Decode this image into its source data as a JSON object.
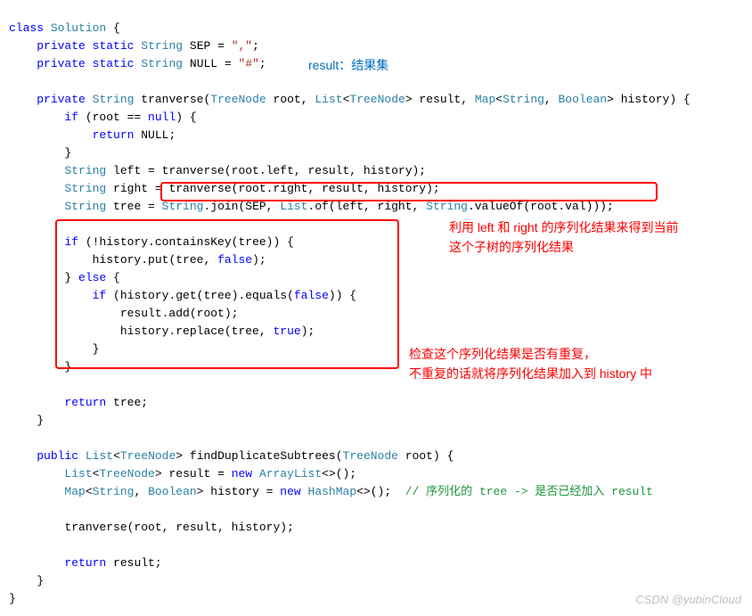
{
  "anno1": "result：结果集",
  "anno2": "利用 left 和 right 的序列化结果来得到当前\n这个子树的序列化结果",
  "anno3": "检查这个序列化结果是否有重复，\n不重复的话就将序列化结果加入到 history 中",
  "watermark": "CSDN @yubinCloud",
  "code": {
    "l01_kw1": "class",
    "l01_type1": "Solution",
    "l01_pt1": " {",
    "l02_kw1": "private",
    "l02_kw2": "static",
    "l02_type1": "String",
    "l02_id1": "SEP",
    "l02_pt1": " = ",
    "l02_str1": "\",\"",
    "l02_pt2": ";",
    "l03_kw1": "private",
    "l03_kw2": "static",
    "l03_type1": "String",
    "l03_id1": "NULL",
    "l03_pt1": " = ",
    "l03_str1": "\"#\"",
    "l03_pt2": ";",
    "l05_kw1": "private",
    "l05_type1": "String",
    "l05_id1": "tranverse",
    "l05_pt1": "(",
    "l05_type2": "TreeNode",
    "l05_id2": "root",
    "l05_pt2": ", ",
    "l05_type3": "List",
    "l05_pt3": "<",
    "l05_type4": "TreeNode",
    "l05_pt4": "> ",
    "l05_id3": "result",
    "l05_pt5": ", ",
    "l05_type5": "Map",
    "l05_pt6": "<",
    "l05_type6": "String",
    "l05_pt7": ", ",
    "l05_type7": "Boolean",
    "l05_pt8": "> ",
    "l05_id4": "history",
    "l05_pt9": ") {",
    "l06_kw1": "if",
    "l06_pt1": " (root == ",
    "l06_kw2": "null",
    "l06_pt2": ") {",
    "l07_kw1": "return",
    "l07_id1": " NULL;",
    "l08_pt1": "}",
    "l09_type1": "String",
    "l09_id1": " left = tranverse(root.left, result, history);",
    "l10_type1": "String",
    "l10_id1": " right = tranverse(root.right, result, history);",
    "l11_type1": "String",
    "l11_id1": " tree = ",
    "l11_type2": "String",
    "l11_id2": ".join(SEP, ",
    "l11_type3": "List",
    "l11_id3": ".of(left, right, ",
    "l11_type4": "String",
    "l11_id4": ".valueOf(root.val)));",
    "l13_kw1": "if",
    "l13_pt1": " (!history.containsKey(tree)) {",
    "l14_id1": "history.put(tree, ",
    "l14_kw1": "false",
    "l14_pt1": ");",
    "l15_pt1": "} ",
    "l15_kw1": "else",
    "l15_pt2": " {",
    "l16_kw1": "if",
    "l16_pt1": " (history.get(tree).equals(",
    "l16_kw2": "false",
    "l16_pt2": ")) {",
    "l17_id1": "result.add(root);",
    "l18_id1": "history.replace(tree, ",
    "l18_kw1": "true",
    "l18_pt1": ");",
    "l19_pt1": "}",
    "l20_pt1": "}",
    "l22_kw1": "return",
    "l22_id1": " tree;",
    "l23_pt1": "}",
    "l25_kw1": "public",
    "l25_type1": "List",
    "l25_pt1": "<",
    "l25_type2": "TreeNode",
    "l25_pt2": "> ",
    "l25_id1": "findDuplicateSubtrees",
    "l25_pt3": "(",
    "l25_type3": "TreeNode",
    "l25_id2": " root) {",
    "l26_type1": "List",
    "l26_pt1": "<",
    "l26_type2": "TreeNode",
    "l26_pt2": "> result = ",
    "l26_kw1": "new",
    "l26_pt3": " ",
    "l26_type3": "ArrayList",
    "l26_pt4": "<>();",
    "l27_type1": "Map",
    "l27_pt1": "<",
    "l27_type2": "String",
    "l27_pt2": ", ",
    "l27_type3": "Boolean",
    "l27_pt3": "> history = ",
    "l27_kw1": "new",
    "l27_pt4": " ",
    "l27_type4": "HashMap",
    "l27_pt5": "<>();  ",
    "l27_cmt1": "// 序列化的 tree -> 是否已经加入 result",
    "l29_id1": "tranverse(root, result, history);",
    "l31_kw1": "return",
    "l31_id1": " result;",
    "l32_pt1": "}",
    "l33_pt1": "}"
  }
}
